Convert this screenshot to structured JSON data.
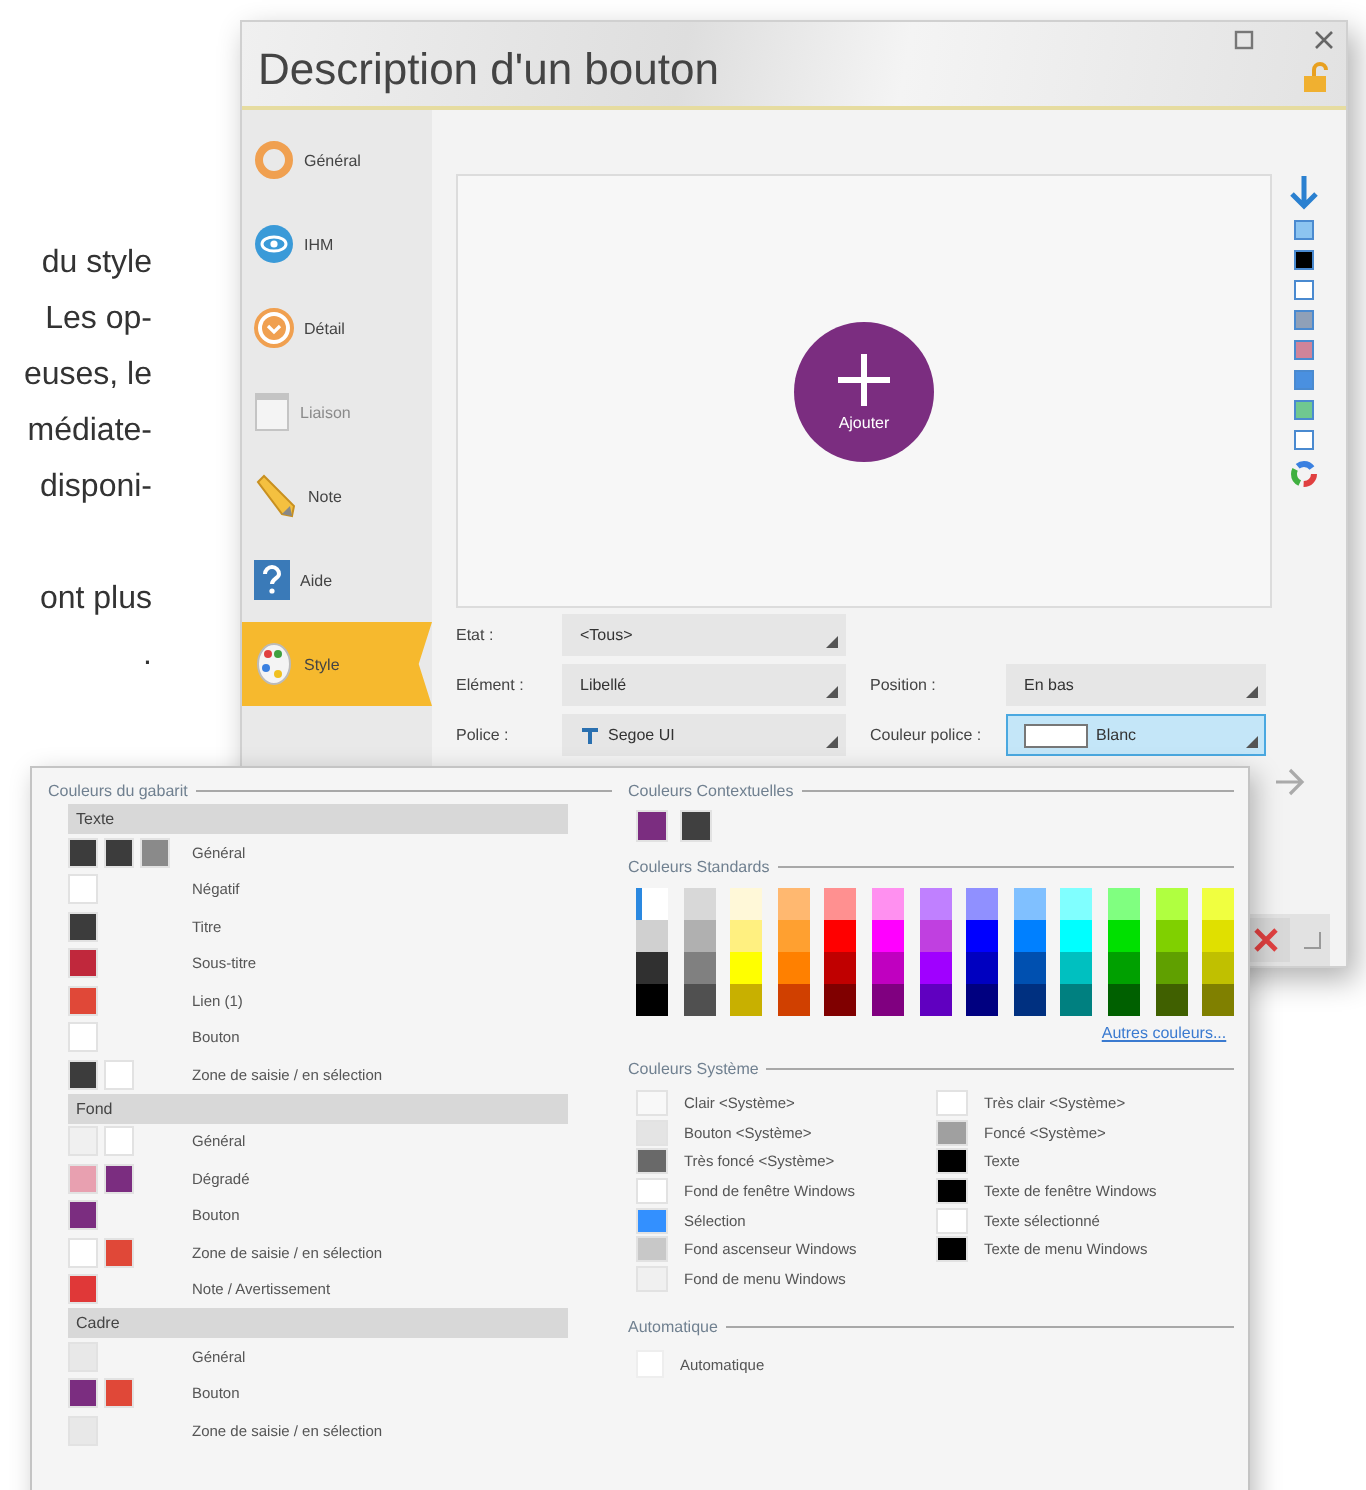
{
  "document_text": [
    {
      "lines": [
        "du style",
        "Les op-",
        "euses, le",
        "médiate-",
        "disponi-"
      ]
    },
    {
      "lines": [
        "ont plus",
        "."
      ]
    }
  ],
  "window": {
    "title": "Description d'un bouton"
  },
  "sidebar": {
    "items": [
      {
        "label": "Général",
        "selected": false,
        "disabled": false
      },
      {
        "label": "IHM",
        "selected": false,
        "disabled": false
      },
      {
        "label": "Détail",
        "selected": false,
        "disabled": false
      },
      {
        "label": "Liaison",
        "selected": false,
        "disabled": true
      },
      {
        "label": "Note",
        "selected": false,
        "disabled": false
      },
      {
        "label": "Aide",
        "selected": false,
        "disabled": false
      },
      {
        "label": "Style",
        "selected": true,
        "disabled": false
      }
    ]
  },
  "preview": {
    "button_label": "Ajouter"
  },
  "style_swatches": [
    {
      "color": "#8cc4f0"
    },
    {
      "color": "#000000"
    },
    {
      "color": "#ffffff"
    },
    {
      "color": "#8fa0b8"
    },
    {
      "color": "#d0849a"
    },
    {
      "color": "#4a90e0"
    },
    {
      "color": "#70c890"
    },
    {
      "color": "#ffffff"
    }
  ],
  "form": {
    "fields": [
      {
        "label": "Etat :",
        "value": "<Tous>",
        "expanded": false
      },
      {
        "label": "Elément :",
        "value": "Libellé",
        "expanded": false
      },
      {
        "label": "Position :",
        "value": "En bas",
        "expanded": false
      },
      {
        "label": "Police :",
        "value": "Segoe UI",
        "expanded": false
      },
      {
        "label": "Couleur police :",
        "value": "Blanc",
        "expanded": true
      }
    ]
  },
  "color_popup": {
    "template": {
      "legend": "Couleurs du gabarit",
      "groups": [
        {
          "title": "Texte",
          "rows": [
            {
              "label": "Général",
              "swatches": [
                {
                  "color": "#3c3c3c"
                },
                {
                  "color": "#3c3c3c"
                },
                {
                  "color": "#8a8a8a"
                }
              ]
            },
            {
              "label": "Négatif",
              "swatches": [
                {
                  "color": "#ffffff"
                }
              ]
            },
            {
              "label": "Titre",
              "swatches": [
                {
                  "color": "#3c3c3c"
                }
              ]
            },
            {
              "label": "Sous-titre",
              "swatches": [
                {
                  "color": "#c0283c"
                }
              ]
            },
            {
              "label": "Lien (1)",
              "swatches": [
                {
                  "color": "#e04838"
                }
              ]
            },
            {
              "label": "Bouton",
              "swatches": [
                {
                  "color": "#ffffff"
                }
              ]
            },
            {
              "label": "Zone de saisie / en sélection",
              "swatches": [
                {
                  "color": "#3c3c3c"
                },
                {
                  "color": "#ffffff"
                }
              ]
            }
          ]
        },
        {
          "title": "Fond",
          "rows": [
            {
              "label": "Général",
              "swatches": [
                {
                  "color": "#f0f0f0"
                },
                {
                  "color": "#ffffff"
                }
              ]
            },
            {
              "label": "Dégradé",
              "swatches": [
                {
                  "color": "#e8a0b0"
                },
                {
                  "color": "#7b2d80"
                }
              ]
            },
            {
              "label": "Bouton",
              "swatches": [
                {
                  "color": "#7b2d80"
                }
              ]
            },
            {
              "label": "Zone de saisie / en sélection",
              "swatches": [
                {
                  "color": "#ffffff"
                },
                {
                  "color": "#e04838"
                }
              ]
            },
            {
              "label": "Note / Avertissement",
              "swatches": [
                {
                  "color": "#e03838"
                }
              ]
            }
          ]
        },
        {
          "title": "Cadre",
          "rows": [
            {
              "label": "Général",
              "swatches": [
                {
                  "color": "#e8e8e8"
                }
              ]
            },
            {
              "label": "Bouton",
              "swatches": [
                {
                  "color": "#7b2d80"
                },
                {
                  "color": "#e04838"
                }
              ]
            },
            {
              "label": "Zone de saisie / en sélection",
              "swatches": [
                {
                  "color": "#e8e8e8"
                }
              ]
            }
          ]
        }
      ]
    },
    "contextual": {
      "legend": "Couleurs Contextuelles",
      "swatches": [
        {
          "color": "#7b2d80"
        },
        {
          "color": "#404040"
        }
      ]
    },
    "standard": {
      "legend": "Couleurs Standards",
      "link": "Autres couleurs...",
      "columns": [
        {
          "cells": [
            {
              "color": "#ffffff",
              "selected": true
            },
            {
              "color": "#d0d0d0",
              "selected": false
            },
            {
              "color": "#303030",
              "selected": false
            },
            {
              "color": "#000000",
              "selected": false
            }
          ]
        },
        {
          "cells": [
            {
              "color": "#d8d8d8",
              "selected": false
            },
            {
              "color": "#b0b0b0",
              "selected": false
            },
            {
              "color": "#808080",
              "selected": false
            },
            {
              "color": "#505050",
              "selected": false
            }
          ]
        },
        {
          "cells": [
            {
              "color": "#fff8d8",
              "selected": false
            },
            {
              "color": "#fff080",
              "selected": false
            },
            {
              "color": "#ffff00",
              "selected": false
            },
            {
              "color": "#c8b000",
              "selected": false
            }
          ]
        },
        {
          "cells": [
            {
              "color": "#ffb870",
              "selected": false
            },
            {
              "color": "#ffa030",
              "selected": false
            },
            {
              "color": "#ff8000",
              "selected": false
            },
            {
              "color": "#d04000",
              "selected": false
            }
          ]
        },
        {
          "cells": [
            {
              "color": "#ff9090",
              "selected": false
            },
            {
              "color": "#ff0000",
              "selected": false
            },
            {
              "color": "#c00000",
              "selected": false
            },
            {
              "color": "#800000",
              "selected": false
            }
          ]
        },
        {
          "cells": [
            {
              "color": "#ff90f0",
              "selected": false
            },
            {
              "color": "#ff00ff",
              "selected": false
            },
            {
              "color": "#c000c0",
              "selected": false
            },
            {
              "color": "#800080",
              "selected": false
            }
          ]
        },
        {
          "cells": [
            {
              "color": "#c080ff",
              "selected": false
            },
            {
              "color": "#c040e0",
              "selected": false
            },
            {
              "color": "#a000ff",
              "selected": false
            },
            {
              "color": "#6000c0",
              "selected": false
            }
          ]
        },
        {
          "cells": [
            {
              "color": "#9090ff",
              "selected": false
            },
            {
              "color": "#0000ff",
              "selected": false
            },
            {
              "color": "#0000c0",
              "selected": false
            },
            {
              "color": "#000080",
              "selected": false
            }
          ]
        },
        {
          "cells": [
            {
              "color": "#80c0ff",
              "selected": false
            },
            {
              "color": "#0080ff",
              "selected": false
            },
            {
              "color": "#0050b0",
              "selected": false
            },
            {
              "color": "#003080",
              "selected": false
            }
          ]
        },
        {
          "cells": [
            {
              "color": "#80ffff",
              "selected": false
            },
            {
              "color": "#00ffff",
              "selected": false
            },
            {
              "color": "#00c0c0",
              "selected": false
            },
            {
              "color": "#008080",
              "selected": false
            }
          ]
        },
        {
          "cells": [
            {
              "color": "#80ff80",
              "selected": false
            },
            {
              "color": "#00e000",
              "selected": false
            },
            {
              "color": "#00a000",
              "selected": false
            },
            {
              "color": "#006000",
              "selected": false
            }
          ]
        },
        {
          "cells": [
            {
              "color": "#b0ff40",
              "selected": false
            },
            {
              "color": "#80d000",
              "selected": false
            },
            {
              "color": "#60a000",
              "selected": false
            },
            {
              "color": "#406000",
              "selected": false
            }
          ]
        },
        {
          "cells": [
            {
              "color": "#f0ff40",
              "selected": false
            },
            {
              "color": "#e0e000",
              "selected": false
            },
            {
              "color": "#c0c000",
              "selected": false
            },
            {
              "color": "#808000",
              "selected": false
            }
          ]
        }
      ]
    },
    "system": {
      "legend": "Couleurs Système",
      "columns": [
        {
          "items": [
            {
              "label": "Clair <Système>",
              "color": "#f8f8f8"
            },
            {
              "label": "Bouton <Système>",
              "color": "#e4e4e4"
            },
            {
              "label": "Très foncé <Système>",
              "color": "#696969"
            },
            {
              "label": "Fond de fenêtre Windows",
              "color": "#ffffff"
            },
            {
              "label": "Sélection",
              "color": "#3390ff"
            },
            {
              "label": "Fond ascenseur Windows",
              "color": "#c8c8c8"
            },
            {
              "label": "Fond de menu Windows",
              "color": "#f0f0f0"
            }
          ]
        },
        {
          "items": [
            {
              "label": "Très clair <Système>",
              "color": "#ffffff"
            },
            {
              "label": "Foncé <Système>",
              "color": "#a0a0a0"
            },
            {
              "label": "Texte",
              "color": "#000000"
            },
            {
              "label": "Texte de fenêtre Windows",
              "color": "#000000"
            },
            {
              "label": "Texte sélectionné",
              "color": "#ffffff"
            },
            {
              "label": "Texte de menu Windows",
              "color": "#000000"
            }
          ]
        }
      ]
    },
    "automatic": {
      "legend": "Automatique",
      "label": "Automatique",
      "checked": false
    }
  }
}
